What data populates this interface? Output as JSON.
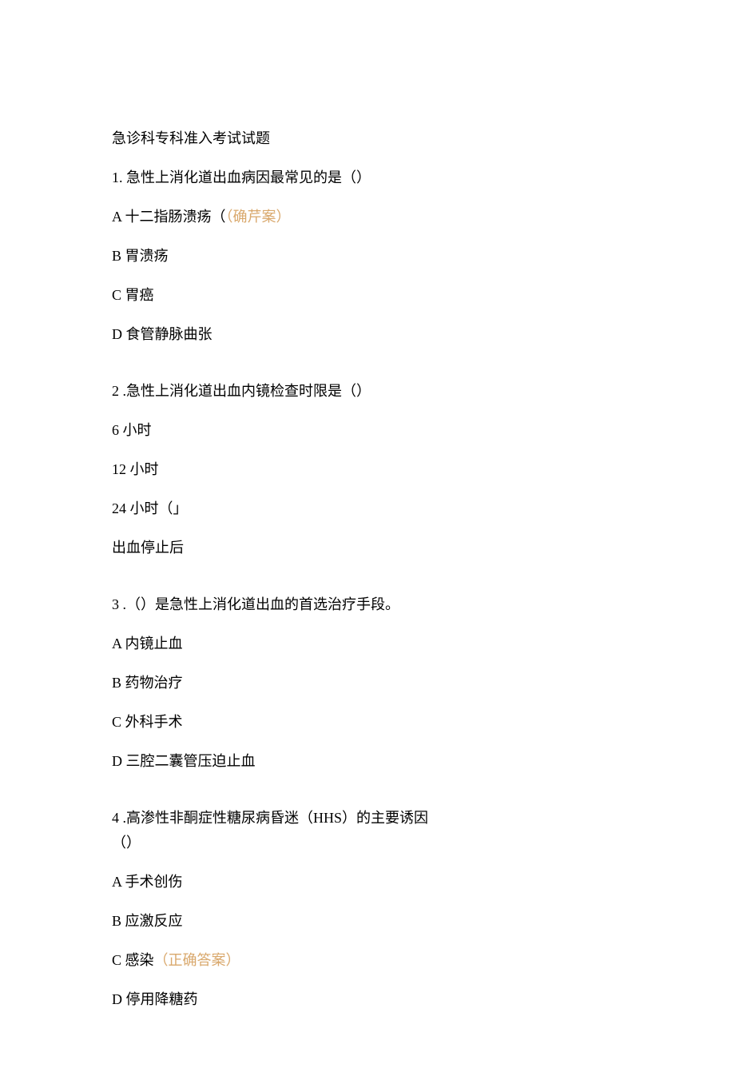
{
  "title": "急诊科专科准入考试试题",
  "questions": [
    {
      "number": "1.",
      "text": "急性上消化道出血病因最常见的是（）",
      "options": [
        {
          "label": "A 十二指肠溃疡（",
          "answer": "（确芹案）",
          "answerClass": true
        },
        {
          "label": "B 胃溃疡"
        },
        {
          "label": "C 胃癌"
        },
        {
          "label": "D 食管静脉曲张"
        }
      ]
    },
    {
      "number": "2",
      "text": " .急性上消化道出血内镜检查时限是（）",
      "options": [
        {
          "label": "6 小时"
        },
        {
          "label": "12 小时"
        },
        {
          "label": "24 小时（」"
        },
        {
          "label": "出血停止后"
        }
      ]
    },
    {
      "number": "3",
      "text": " .（）是急性上消化道出血的首选治疗手段。",
      "options": [
        {
          "label": "A 内镜止血"
        },
        {
          "label": "B 药物治疗"
        },
        {
          "label": "C 外科手术"
        },
        {
          "label": "D 三腔二囊管压迫止血"
        }
      ]
    },
    {
      "number": "4",
      "text": " .高渗性非酮症性糖尿病昏迷（HHS）的主要诱因",
      "textLine2": "（）",
      "options": [
        {
          "label": "A 手术创伤"
        },
        {
          "label": "B 应激反应"
        },
        {
          "label": "C 感染",
          "answer": "（正确答案）",
          "answerClass": true
        },
        {
          "label": "D 停用降糖药"
        }
      ]
    }
  ]
}
